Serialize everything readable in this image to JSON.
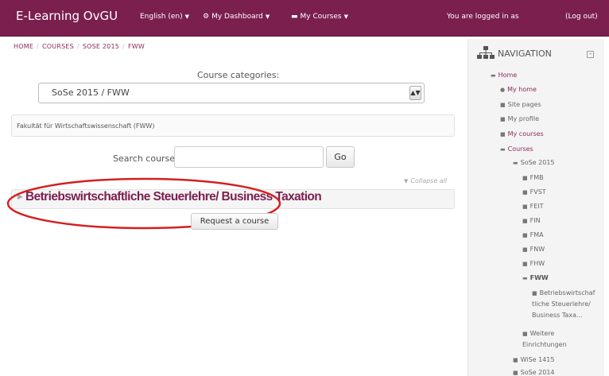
{
  "navbar": {
    "brand": "E-Learning OvGU",
    "language": "English (en)",
    "dashboard": "My Dashboard",
    "courses": "My Courses",
    "logged_in": "You are logged in as",
    "logout": "(Log out)"
  },
  "breadcrumb": [
    "HOME",
    "COURSES",
    "SOSE 2015",
    "FWW"
  ],
  "main": {
    "categories_label": "Course categories:",
    "selected_category": "SoSe 2015 / FWW",
    "category_description": "Fakultät für Wirtschaftswissenschaft (FWW)",
    "search_label": "Search courses:",
    "search_value": "",
    "go_label": "Go",
    "collapse_label": "Collapse all",
    "course_title": "Betriebswirtschaftliche Steuerlehre/ Business Taxation",
    "request_label": "Request a course"
  },
  "sidebar": {
    "title": "NAVIGATION",
    "home": "Home",
    "my_home": "My home",
    "site_pages": "Site pages",
    "my_profile": "My profile",
    "my_courses": "My courses",
    "courses": "Courses",
    "sose2015": "SoSe 2015",
    "faculties": [
      "FMB",
      "FVST",
      "FEIT",
      "FIN",
      "FMA",
      "FNW",
      "FHW"
    ],
    "fww": "FWW",
    "course_l1": "Betriebswirtschaf",
    "course_l2": "tliche Steuerlehre/",
    "course_l3": "Business Taxa...",
    "weitere_l1": "Weitere",
    "weitere_l2": "Einrichtungen",
    "wise1415": "WiSe 1415",
    "sose2014": "SoSe 2014"
  },
  "colors": {
    "brand": "#7b1f4f",
    "link": "#8a2a5a",
    "highlight": "#d42020"
  }
}
